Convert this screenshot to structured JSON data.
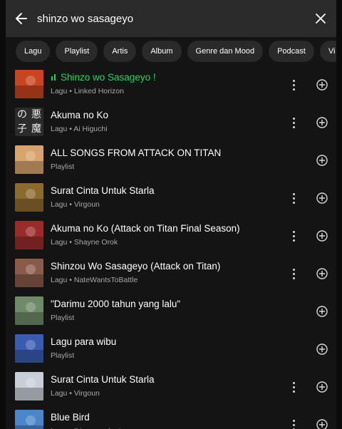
{
  "search": {
    "query": "shinzo wo sasageyo"
  },
  "filters": [
    "Lagu",
    "Playlist",
    "Artis",
    "Album",
    "Genre dan Mood",
    "Podcast",
    "Vi"
  ],
  "results": [
    {
      "title": "Shinzo wo Sasageyo !",
      "subtitle": "Lagu • Linked Horizon",
      "playing": true,
      "has_more": true,
      "thumb_color": "#c8451f"
    },
    {
      "title": "Akuma no Ko",
      "subtitle": "Lagu • Ai Higuchi",
      "playing": false,
      "has_more": true,
      "thumb_text": "の悪子魔",
      "thumb_color": "#2b2b2b"
    },
    {
      "title": "ALL SONGS FROM ATTACK ON TITAN",
      "subtitle": "Playlist",
      "playing": false,
      "has_more": false,
      "thumb_color": "#d7a36e"
    },
    {
      "title": "Surat Cinta Untuk Starla",
      "subtitle": "Lagu • Virgoun",
      "playing": false,
      "has_more": true,
      "thumb_color": "#8c6a2e"
    },
    {
      "title": "Akuma no Ko (Attack on Titan Final Season)",
      "subtitle": "Lagu • Shayne Orok",
      "playing": false,
      "has_more": true,
      "thumb_color": "#9a2b2b"
    },
    {
      "title": "Shinzou Wo Sasageyo (Attack on Titan)",
      "subtitle": "Lagu • NateWantsToBattle",
      "playing": false,
      "has_more": true,
      "thumb_color": "#8a5a4a"
    },
    {
      "title": "\"Darimu 2000 tahun yang lalu\"",
      "subtitle": "Playlist",
      "playing": false,
      "has_more": false,
      "thumb_color": "#6f8a6a"
    },
    {
      "title": "Lagu para wibu",
      "subtitle": "Playlist",
      "playing": false,
      "has_more": false,
      "thumb_color": "#3a5bb0"
    },
    {
      "title": "Surat Cinta Untuk Starla",
      "subtitle": "Lagu • Virgoun",
      "playing": false,
      "has_more": true,
      "thumb_color": "#c9cfd8"
    },
    {
      "title": "Blue Bird",
      "subtitle": "Lagu • Ikimonogakari",
      "playing": false,
      "has_more": true,
      "thumb_color": "#4a86c9"
    }
  ],
  "colors": {
    "accent": "#1ed760",
    "background": "#141414",
    "chip": "#2a2a2a"
  },
  "icons": {
    "back": "arrow-left-icon",
    "clear": "close-icon",
    "more": "more-vertical-icon",
    "add": "add-circle-icon",
    "playing": "equalizer-icon"
  }
}
